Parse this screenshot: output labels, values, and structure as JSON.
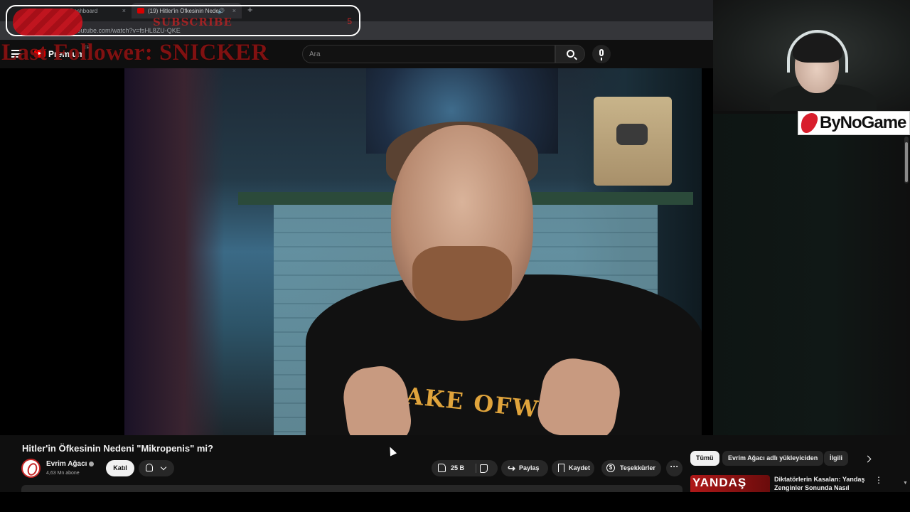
{
  "browser": {
    "tabs": [
      {
        "label": "Dashboard",
        "active": false
      },
      {
        "label": "(19) Hitler'in Öfkesinin Nede",
        "active": true
      }
    ],
    "tab_close_glyph": "×",
    "audio_glyph": "🔊",
    "new_tab_glyph": "+",
    "url": "youtube.com/watch?v=fsHL8ZU-QKE"
  },
  "stream_overlay": {
    "subscribe_text": "SUBSCRIBE",
    "subscribe_count": "5",
    "title_text": "Last Follower: SNICKER",
    "brand": "ByNoGame"
  },
  "youtube_header": {
    "logo_text": "Premium",
    "country_code": "TR",
    "search_placeholder": "Ara"
  },
  "video": {
    "shirt_text": "AKE OFWELL"
  },
  "video_info": {
    "title": "Hitler'in Öfkesinin Nedeni \"Mikropenis\" mi?",
    "channel_name": "Evrim Ağacı",
    "subscribers": "4,63 Mn abone",
    "join_label": "Katıl",
    "like_count": "25 B",
    "share_label": "Paylaş",
    "save_label": "Kaydet",
    "thanks_label": "Teşekkürler",
    "more_glyph": "···"
  },
  "related": {
    "chips": [
      "Tümü",
      "Evrim Ağacı adlı yükleyiciden",
      "İlgili"
    ],
    "first_video": {
      "thumb_text": "YANDAŞ",
      "title": "Diktatörlerin Kasaları: Yandaş Zenginler Sonunda Nasıl"
    },
    "menu_glyph": "⋮"
  },
  "colors": {
    "youtube_red": "#ff0000",
    "page_bg": "#0f0f0f",
    "overlay_red": "#960f14",
    "shirt_text": "#e0a43c"
  },
  "icons": [
    "menu-icon",
    "youtube-logo",
    "search-icon",
    "mic-icon",
    "verified-icon",
    "bell-icon",
    "chevron-down-icon",
    "like-icon",
    "dislike-icon",
    "share-icon",
    "save-icon",
    "thanks-icon",
    "more-icon",
    "chevron-right-icon",
    "kebab-menu-icon"
  ]
}
